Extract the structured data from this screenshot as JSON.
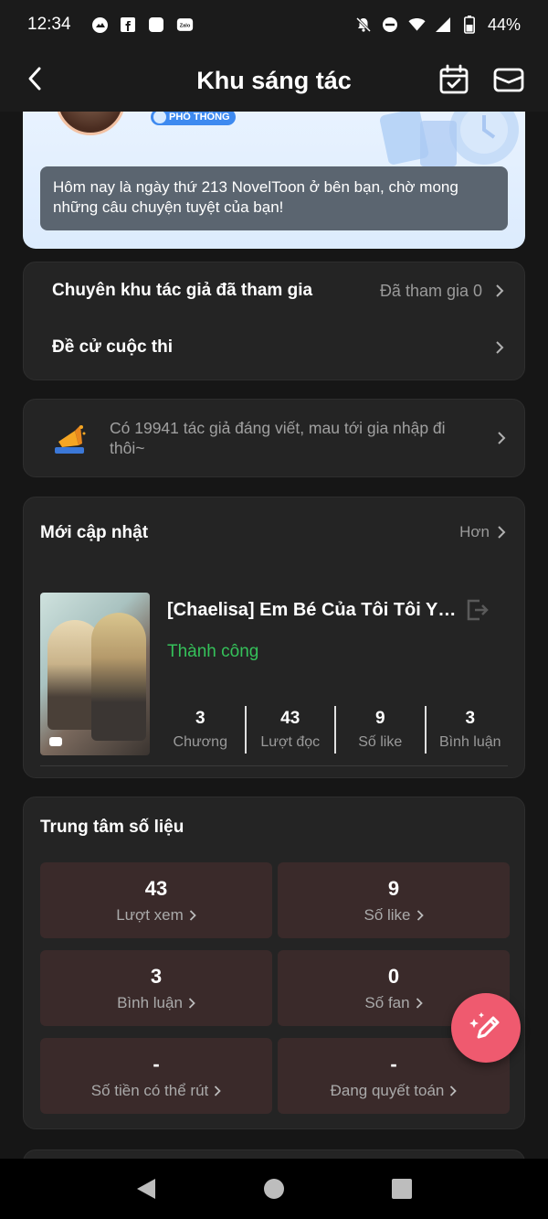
{
  "status_bar": {
    "time": "12:34",
    "battery": "44%",
    "left_icons": [
      "photo-icon",
      "facebook-icon",
      "square-app-icon",
      "zalo-icon"
    ],
    "zalo_label": "Zalo",
    "right_icons": [
      "notifications-off-icon",
      "do-not-disturb-icon",
      "wifi-icon",
      "signal-icon",
      "battery-icon"
    ]
  },
  "nav": {
    "title": "Khu sáng tác",
    "back_icon": "back-arrow-icon",
    "calendar_icon": "calendar-check-icon",
    "mail_icon": "mail-icon"
  },
  "hero": {
    "badge": "PHỔ THÔNG",
    "message": "Hôm nay là ngày thứ 213 NovelToon ở bên bạn, chờ mong những câu chuyện tuyệt của bạn!"
  },
  "links": [
    {
      "label": "Chuyên khu tác giả đã tham gia",
      "value": "Đã tham gia 0"
    },
    {
      "label": "Đề cử cuộc thi",
      "value": ""
    }
  ],
  "invite": {
    "text": "Có 19941 tác giả đáng viết, mau tới gia nhập đi thôi~"
  },
  "updates": {
    "title": "Mới cập nhật",
    "more": "Hơn",
    "book": {
      "title": "[Chaelisa] Em Bé Của Tôi Tôi Yêu Nhiều Lắm",
      "status": "Thành công",
      "status_color": "#35c15a",
      "stats": [
        {
          "value": "3",
          "label": "Chương"
        },
        {
          "value": "43",
          "label": "Lượt đọc"
        },
        {
          "value": "9",
          "label": "Số like"
        },
        {
          "value": "3",
          "label": "Bình luận"
        }
      ]
    }
  },
  "data_center": {
    "title": "Trung tâm số liệu",
    "tiles": [
      {
        "value": "43",
        "label": "Lượt xem"
      },
      {
        "value": "9",
        "label": "Số like"
      },
      {
        "value": "3",
        "label": "Bình luận"
      },
      {
        "value": "0",
        "label": "Số fan"
      },
      {
        "value": "-",
        "label": "Số tiền có thể rút"
      },
      {
        "value": "-",
        "label": "Đang quyết toán"
      }
    ]
  },
  "colors": {
    "accent_fab": "#ef5a6f",
    "tile_bg": "#3a2a2a",
    "card_bg": "#242424"
  }
}
